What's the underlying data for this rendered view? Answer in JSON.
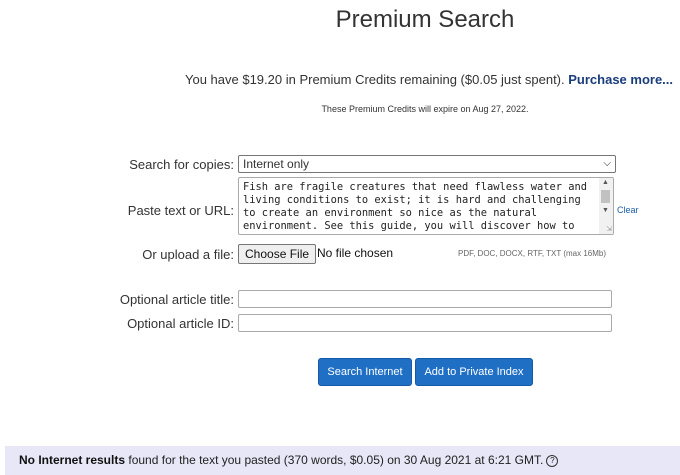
{
  "header": {
    "title": "Premium Search"
  },
  "credits": {
    "text": "You have $19.20 in Premium Credits remaining ($0.05 just spent).",
    "purchase_link": "Purchase more...",
    "expire_note": "These Premium Credits will expire on Aug 27, 2022."
  },
  "form": {
    "search_for_label": "Search for copies:",
    "search_for_value": "Internet only",
    "paste_label": "Paste text or URL:",
    "paste_value": "Fish are fragile creatures that need flawless water and living conditions to exist; it is hard and challenging to create an environment so nice as the natural environment. See this guide, you will discover how to",
    "clear_label": "Clear",
    "upload_label": "Or upload a file:",
    "choose_file_label": "Choose File",
    "no_file_label": "No file chosen",
    "formats_note": "PDF, DOC, DOCX, RTF, TXT (max 16Mb)",
    "article_title_label": "Optional article title:",
    "article_title_value": "",
    "article_id_label": "Optional article ID:",
    "article_id_value": ""
  },
  "buttons": {
    "search_internet": "Search Internet",
    "add_private_index": "Add to Private Index"
  },
  "result_banner": {
    "bold": "No Internet results",
    "text": " found for the text you pasted (370 words, $0.05) on 30 Aug 2021 at 6:21 GMT."
  },
  "colors": {
    "accent": "#1f6fc5",
    "link": "#1a3d7c",
    "banner_bg": "#e7e7f7"
  },
  "icons": {
    "help": "question-circle-icon",
    "dropdown": "chevron-down-icon"
  }
}
